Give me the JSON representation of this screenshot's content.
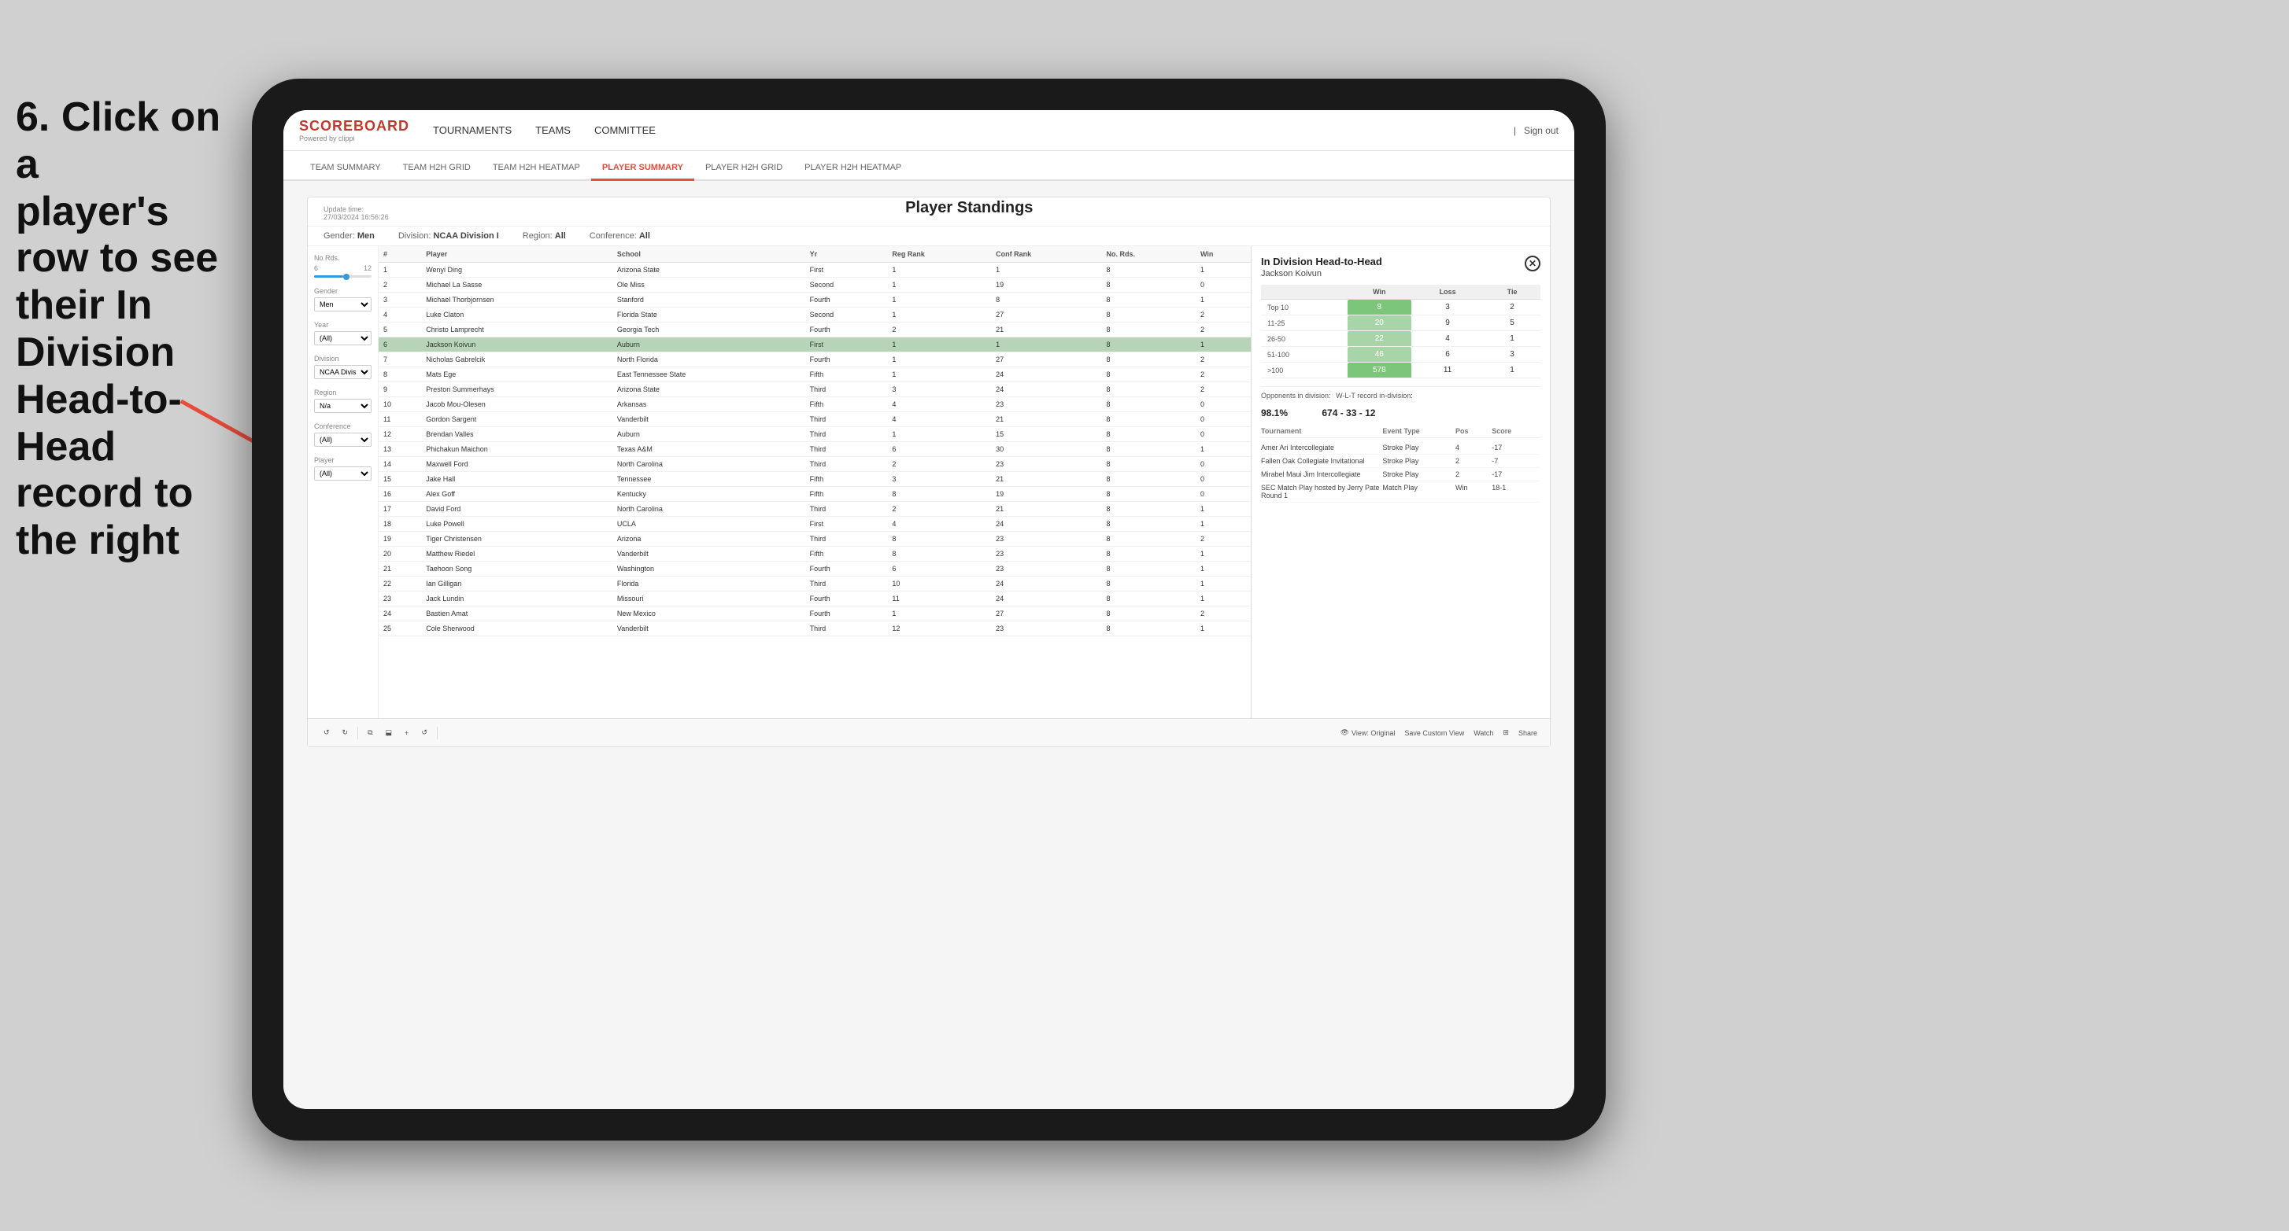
{
  "instruction": {
    "line1": "6. Click on a",
    "line2": "player's row to see",
    "line3": "their In Division",
    "line4": "Head-to-Head",
    "line5": "record to the right"
  },
  "nav": {
    "logo": "SCOREBOARD",
    "logo_sub": "Powered by clippi",
    "items": [
      "TOURNAMENTS",
      "TEAMS",
      "COMMITTEE"
    ],
    "sign_out": "Sign out"
  },
  "tabs": [
    {
      "label": "TEAM SUMMARY",
      "active": false
    },
    {
      "label": "TEAM H2H GRID",
      "active": false
    },
    {
      "label": "TEAM H2H HEATMAP",
      "active": false
    },
    {
      "label": "PLAYER SUMMARY",
      "active": true
    },
    {
      "label": "PLAYER H2H GRID",
      "active": false
    },
    {
      "label": "PLAYER H2H HEATMAP",
      "active": false
    }
  ],
  "panel": {
    "update_time": "Update time:",
    "update_datetime": "27/03/2024 16:56:26",
    "title": "Player Standings",
    "filters": {
      "gender_label": "Gender:",
      "gender_value": "Men",
      "division_label": "Division:",
      "division_value": "NCAA Division I",
      "region_label": "Region:",
      "region_value": "All",
      "conference_label": "Conference:",
      "conference_value": "All"
    }
  },
  "sidebar": {
    "no_rds_label": "No Rds.",
    "no_rds_min": "6",
    "no_rds_max": "12",
    "gender_label": "Gender",
    "gender_value": "Men",
    "year_label": "Year",
    "year_value": "(All)",
    "division_label": "Division",
    "division_value": "NCAA Division I",
    "region_label": "Region",
    "region_value": "N/a",
    "conference_label": "Conference",
    "conference_value": "(All)",
    "player_label": "Player",
    "player_value": "(All)"
  },
  "table": {
    "columns": [
      "#",
      "Player",
      "School",
      "Yr",
      "Reg Rank",
      "Conf Rank",
      "No. Rds.",
      "Win"
    ],
    "rows": [
      {
        "num": 1,
        "player": "Wenyi Ding",
        "school": "Arizona State",
        "yr": "First",
        "reg": 1,
        "conf": 1,
        "rds": 8,
        "win": 1
      },
      {
        "num": 2,
        "player": "Michael La Sasse",
        "school": "Ole Miss",
        "yr": "Second",
        "reg": 1,
        "conf": 19,
        "rds": 8,
        "win": 0
      },
      {
        "num": 3,
        "player": "Michael Thorbjornsen",
        "school": "Stanford",
        "yr": "Fourth",
        "reg": 1,
        "conf": 8,
        "rds": 8,
        "win": 1
      },
      {
        "num": 4,
        "player": "Luke Claton",
        "school": "Florida State",
        "yr": "Second",
        "reg": 1,
        "conf": 27,
        "rds": 8,
        "win": 2
      },
      {
        "num": 5,
        "player": "Christo Lamprecht",
        "school": "Georgia Tech",
        "yr": "Fourth",
        "reg": 2,
        "conf": 21,
        "rds": 8,
        "win": 2
      },
      {
        "num": 6,
        "player": "Jackson Koivun",
        "school": "Auburn",
        "yr": "First",
        "reg": 1,
        "conf": 1,
        "rds": 8,
        "win": 1,
        "selected": true
      },
      {
        "num": 7,
        "player": "Nicholas Gabrelcik",
        "school": "North Florida",
        "yr": "Fourth",
        "reg": 1,
        "conf": 27,
        "rds": 8,
        "win": 2
      },
      {
        "num": 8,
        "player": "Mats Ege",
        "school": "East Tennessee State",
        "yr": "Fifth",
        "reg": 1,
        "conf": 24,
        "rds": 8,
        "win": 2
      },
      {
        "num": 9,
        "player": "Preston Summerhays",
        "school": "Arizona State",
        "yr": "Third",
        "reg": 3,
        "conf": 24,
        "rds": 8,
        "win": 2
      },
      {
        "num": 10,
        "player": "Jacob Mou-Olesen",
        "school": "Arkansas",
        "yr": "Fifth",
        "reg": 4,
        "conf": 23,
        "rds": 8,
        "win": 0
      },
      {
        "num": 11,
        "player": "Gordon Sargent",
        "school": "Vanderbilt",
        "yr": "Third",
        "reg": 4,
        "conf": 21,
        "rds": 8,
        "win": 0
      },
      {
        "num": 12,
        "player": "Brendan Valles",
        "school": "Auburn",
        "yr": "Third",
        "reg": 1,
        "conf": 15,
        "rds": 8,
        "win": 0
      },
      {
        "num": 13,
        "player": "Phichakun Maichon",
        "school": "Texas A&M",
        "yr": "Third",
        "reg": 6,
        "conf": 30,
        "rds": 8,
        "win": 1
      },
      {
        "num": 14,
        "player": "Maxwell Ford",
        "school": "North Carolina",
        "yr": "Third",
        "reg": 2,
        "conf": 23,
        "rds": 8,
        "win": 0
      },
      {
        "num": 15,
        "player": "Jake Hall",
        "school": "Tennessee",
        "yr": "Fifth",
        "reg": 3,
        "conf": 21,
        "rds": 8,
        "win": 0
      },
      {
        "num": 16,
        "player": "Alex Goff",
        "school": "Kentucky",
        "yr": "Fifth",
        "reg": 8,
        "conf": 19,
        "rds": 8,
        "win": 0
      },
      {
        "num": 17,
        "player": "David Ford",
        "school": "North Carolina",
        "yr": "Third",
        "reg": 2,
        "conf": 21,
        "rds": 8,
        "win": 1
      },
      {
        "num": 18,
        "player": "Luke Powell",
        "school": "UCLA",
        "yr": "First",
        "reg": 4,
        "conf": 24,
        "rds": 8,
        "win": 1
      },
      {
        "num": 19,
        "player": "Tiger Christensen",
        "school": "Arizona",
        "yr": "Third",
        "reg": 8,
        "conf": 23,
        "rds": 8,
        "win": 2
      },
      {
        "num": 20,
        "player": "Matthew Riedel",
        "school": "Vanderbilt",
        "yr": "Fifth",
        "reg": 8,
        "conf": 23,
        "rds": 8,
        "win": 1
      },
      {
        "num": 21,
        "player": "Taehoon Song",
        "school": "Washington",
        "yr": "Fourth",
        "reg": 6,
        "conf": 23,
        "rds": 8,
        "win": 1
      },
      {
        "num": 22,
        "player": "Ian Gilligan",
        "school": "Florida",
        "yr": "Third",
        "reg": 10,
        "conf": 24,
        "rds": 8,
        "win": 1
      },
      {
        "num": 23,
        "player": "Jack Lundin",
        "school": "Missouri",
        "yr": "Fourth",
        "reg": 11,
        "conf": 24,
        "rds": 8,
        "win": 1
      },
      {
        "num": 24,
        "player": "Bastien Amat",
        "school": "New Mexico",
        "yr": "Fourth",
        "reg": 1,
        "conf": 27,
        "rds": 8,
        "win": 2
      },
      {
        "num": 25,
        "player": "Cole Sherwood",
        "school": "Vanderbilt",
        "yr": "Third",
        "reg": 12,
        "conf": 23,
        "rds": 8,
        "win": 1
      }
    ]
  },
  "h2h": {
    "title": "In Division Head-to-Head",
    "player": "Jackson Koivun",
    "table_headers": [
      "",
      "Win",
      "Loss",
      "Tie"
    ],
    "rows": [
      {
        "label": "Top 10",
        "win": 8,
        "loss": 3,
        "tie": 2
      },
      {
        "label": "11-25",
        "win": 20,
        "loss": 9,
        "tie": 5
      },
      {
        "label": "26-50",
        "win": 22,
        "loss": 4,
        "tie": 1
      },
      {
        "label": "51-100",
        "win": 46,
        "loss": 6,
        "tie": 3
      },
      {
        "label": ">100",
        "win": 578,
        "loss": 11,
        "tie": 1
      }
    ],
    "opponents_label": "Opponents in division:",
    "wlt_label": "W-L-T record in-division:",
    "opponents_pct": "98.1%",
    "wlt_record": "674 - 33 - 12",
    "tournaments_header": [
      "Tournament",
      "Event Type",
      "Pos",
      "Score"
    ],
    "tournaments": [
      {
        "name": "Amer Ari Intercollegiate",
        "type": "Stroke Play",
        "pos": 4,
        "score": "-17"
      },
      {
        "name": "Fallen Oak Collegiate Invitational",
        "type": "Stroke Play",
        "pos": 2,
        "score": "-7"
      },
      {
        "name": "Mirabel Maui Jim Intercollegiate",
        "type": "Stroke Play",
        "pos": 2,
        "score": "-17"
      },
      {
        "name": "SEC Match Play hosted by Jerry Pate Round 1",
        "type": "Match Play",
        "pos": "Win",
        "score": "18-1"
      }
    ]
  },
  "toolbar": {
    "undo": "↺",
    "redo": "↻",
    "copy": "⧉",
    "paste": "⬓",
    "view_original": "View: Original",
    "save_custom": "Save Custom View",
    "watch": "Watch",
    "share": "Share"
  }
}
